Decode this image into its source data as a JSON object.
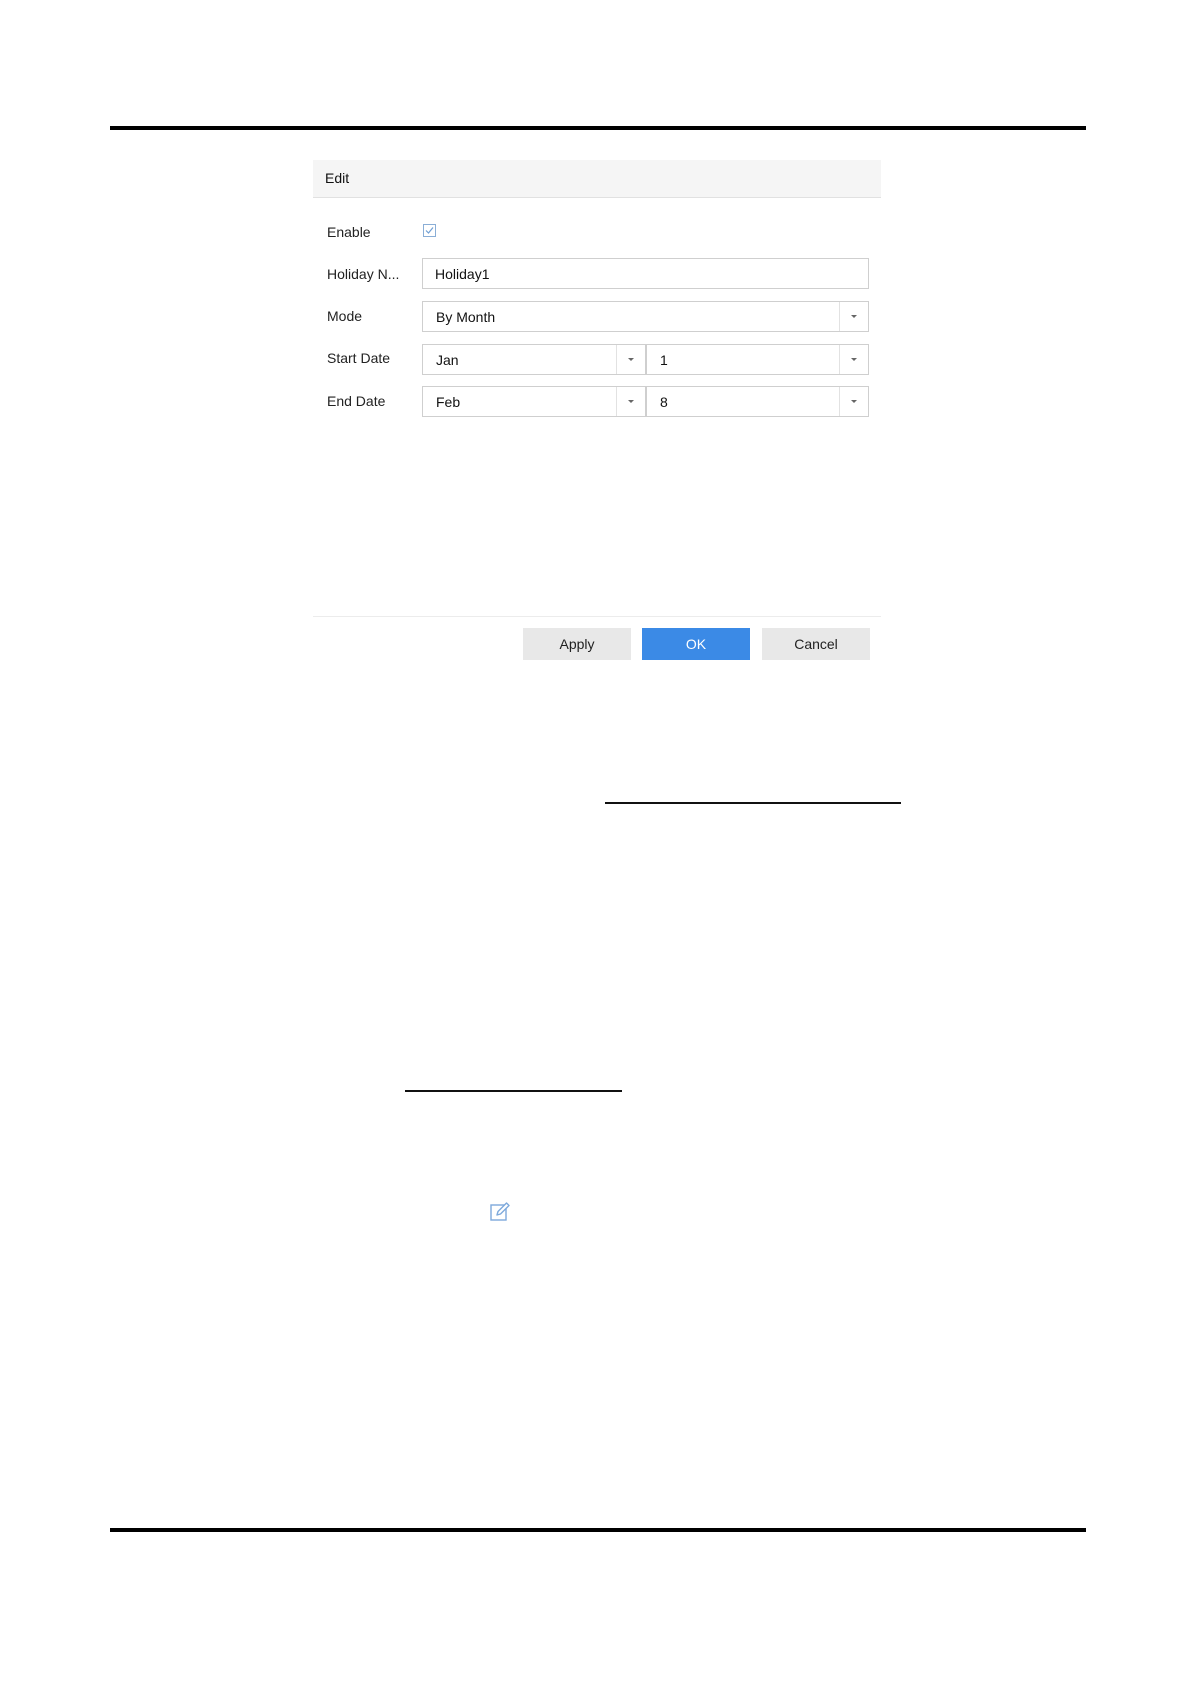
{
  "dialog": {
    "title": "Edit",
    "enable": {
      "label": "Enable",
      "checked": true
    },
    "holiday_name": {
      "label": "Holiday N...",
      "value": "Holiday1"
    },
    "mode": {
      "label": "Mode",
      "value": "By Month"
    },
    "start_date": {
      "label": "Start Date",
      "month": "Jan",
      "day": "1"
    },
    "end_date": {
      "label": "End Date",
      "month": "Feb",
      "day": "8"
    },
    "buttons": {
      "apply": "Apply",
      "ok": "OK",
      "cancel": "Cancel"
    }
  },
  "icons": {
    "edit": "edit-icon",
    "checkbox_check": "checkmark-icon",
    "dropdown": "chevron-down-icon"
  },
  "colors": {
    "primary_button": "#3b8ae6",
    "secondary_button": "#e8e8e8"
  }
}
